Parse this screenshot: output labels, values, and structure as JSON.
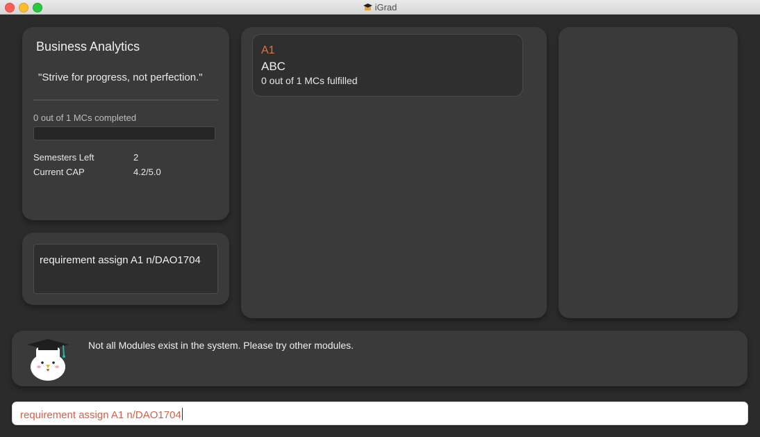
{
  "window": {
    "title": "iGrad",
    "app_icon": "graduation-cap-icon"
  },
  "profile": {
    "course_name": "Business Analytics",
    "quote": "\"Strive for progress, not perfection.\"",
    "mcs_completed_text": "0 out of 1 MCs completed",
    "mcs_progress_fraction": 0,
    "semesters_left_label": "Semesters Left",
    "semesters_left_value": "2",
    "cap_label": "Current CAP",
    "cap_value": "4.2/5.0"
  },
  "history": {
    "last_command": "requirement assign A1 n/DAO1704"
  },
  "requirements": [
    {
      "code": "A1",
      "name": "ABC",
      "mcs_text": "0 out of 1 MCs fulfilled"
    }
  ],
  "result": {
    "message": "Not all Modules exist in the system. Please try other modules.",
    "mascot": "graduate-chicken-icon"
  },
  "command_box": {
    "value": "requirement assign A1 n/DAO1704"
  },
  "colors": {
    "background": "#2b2b2b",
    "panel": "#3a3a3a",
    "accent": "#e0743a",
    "command_text": "#d0614a"
  }
}
